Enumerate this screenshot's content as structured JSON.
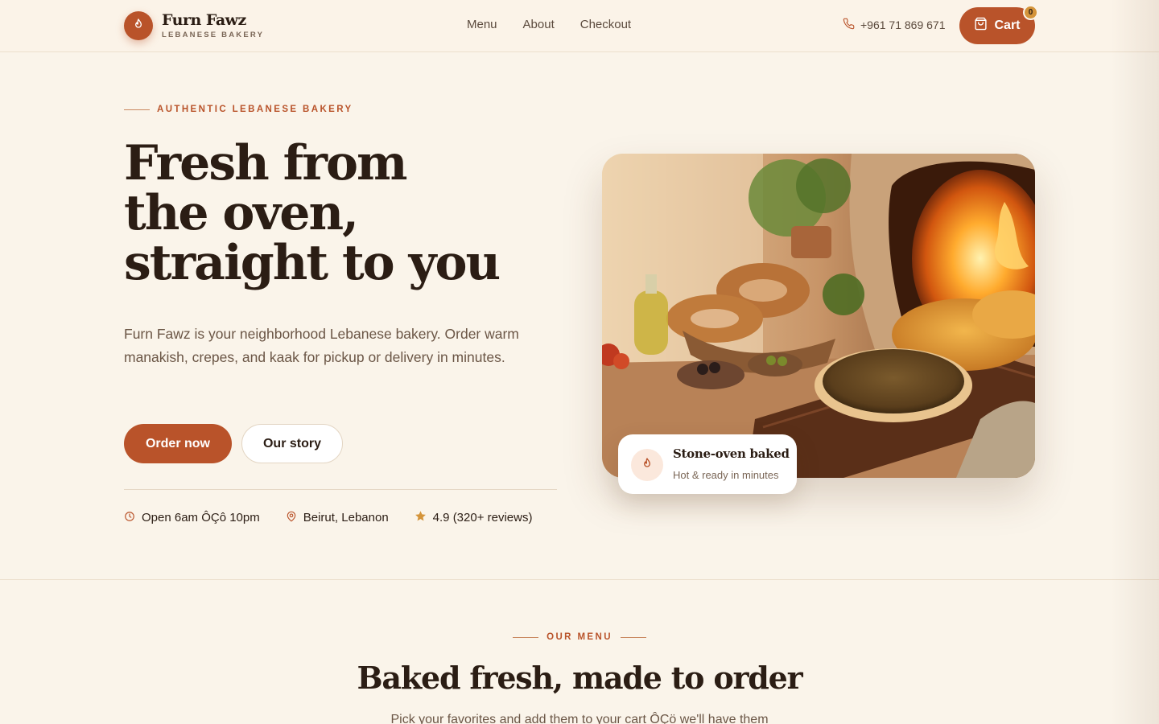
{
  "brand": {
    "name": "Furn Fawz",
    "tagline": "LEBANESE BAKERY",
    "logo_icon": "flame-icon",
    "accent_color": "#b9532a"
  },
  "nav": {
    "items": [
      {
        "label": "Menu"
      },
      {
        "label": "About"
      },
      {
        "label": "Checkout"
      }
    ]
  },
  "header": {
    "phone": "+961 71 869 671",
    "phone_icon": "phone-icon",
    "cart_label": "Cart",
    "cart_count": "0",
    "cart_icon": "shopping-bag-icon"
  },
  "hero": {
    "eyebrow": "AUTHENTIC LEBANESE BAKERY",
    "title_lines": [
      "Fresh from",
      "the oven,",
      "straight to you"
    ],
    "description": "Furn Fawz is your neighborhood Lebanese bakery. Order warm manakish, crepes, and kaak for pickup or delivery in minutes.",
    "primary_button": "Order now",
    "secondary_button": "Our story",
    "facts": [
      {
        "icon": "clock-icon",
        "text": "Open 6am ÔÇô 10pm"
      },
      {
        "icon": "map-pin-icon",
        "text": "Beirut, Lebanon"
      },
      {
        "icon": "star-icon",
        "text": "4.9 (320+ reviews)"
      }
    ],
    "image_alt": "Manakish and kaak on a wooden board beside a stone oven",
    "badge": {
      "title": "Stone-oven baked",
      "subtitle": "Hot & ready in minutes",
      "icon": "flame-icon"
    }
  },
  "menu_section": {
    "eyebrow": "OUR MENU",
    "title": "Baked fresh, made to order",
    "subtitle": "Pick your favorites and add them to your cart ÔÇö we'll have them"
  }
}
